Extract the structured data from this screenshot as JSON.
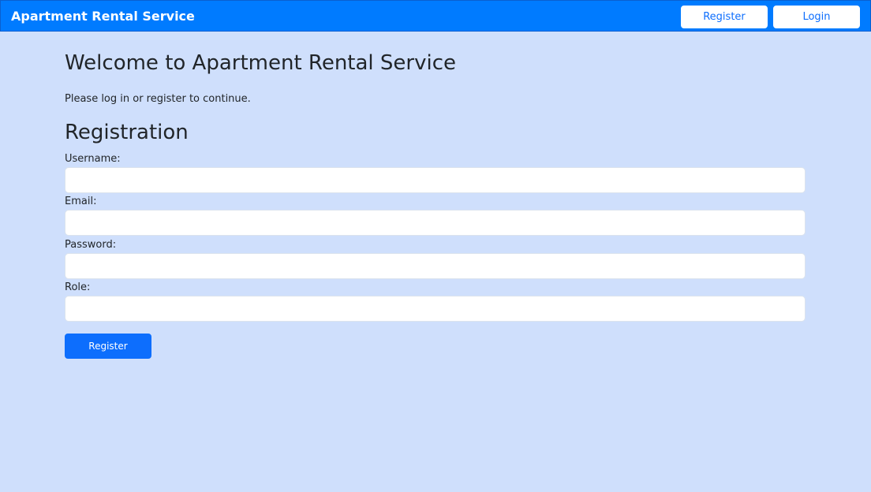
{
  "navbar": {
    "brand": "Apartment Rental Service",
    "register_label": "Register",
    "login_label": "Login"
  },
  "main": {
    "title": "Welcome to Apartment Rental Service",
    "intro": "Please log in or register to continue.",
    "section_title": "Registration"
  },
  "form": {
    "username_label": "Username:",
    "username_value": "",
    "email_label": "Email:",
    "email_value": "",
    "password_label": "Password:",
    "password_value": "",
    "role_label": "Role:",
    "role_value": "",
    "submit_label": "Register"
  },
  "colors": {
    "navbar_bg": "#007bff",
    "page_bg": "#cfdffc",
    "primary_button": "#0d6efd",
    "text": "#212529"
  }
}
